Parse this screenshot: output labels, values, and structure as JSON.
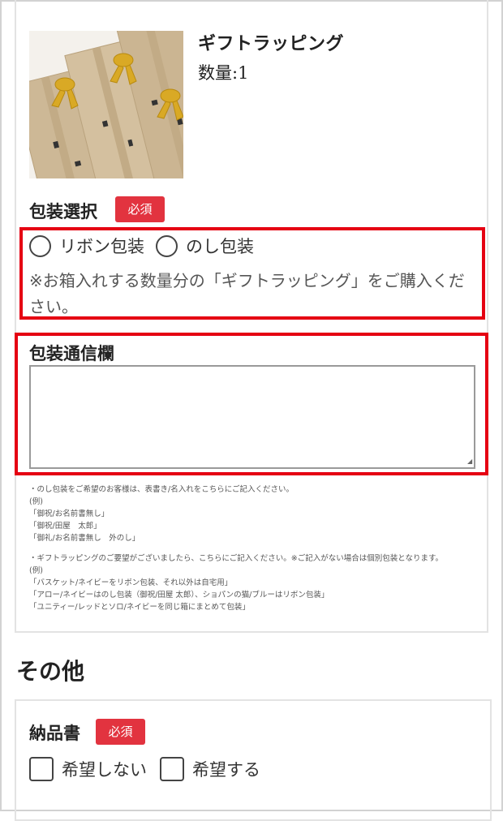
{
  "product": {
    "name": "ギフトラッピング",
    "quantity_label": "数量:1"
  },
  "packaging": {
    "title": "包装選択",
    "required_badge": "必須",
    "options": [
      "リボン包装",
      "のし包装"
    ],
    "note": "※お箱入れする数量分の「ギフトラッピング」をご購入ください。"
  },
  "message": {
    "title": "包装通信欄",
    "value": ""
  },
  "instructions": [
    "・のし包装をご希望のお客様は、表書き/名入れをこちらにご記入ください。",
    "(例)",
    "「御祝/お名前書無し」",
    "「御祝/田屋　太郎」",
    "「御礼/お名前書無し　外のし」",
    "",
    "・ギフトラッピングのご要望がございましたら、こちらにご記入ください。※ご記入がない場合は個別包装となります。",
    "(例)",
    "「バスケット/ネイビーをリボン包装、それ以外は自宅用」",
    "「アロー/ネイビーはのし包装（御祝/田屋 太郎）、ショパンの猫/ブルーはリボン包装」",
    "「ユニティー/レッドとソロ/ネイビーを同じ箱にまとめて包装」"
  ],
  "other": {
    "heading": "その他",
    "delivery_slip": {
      "title": "納品書",
      "required_badge": "必須",
      "options": [
        "希望しない",
        "希望する"
      ]
    }
  },
  "colors": {
    "highlight": "#e50012",
    "badge": "#e2333f"
  }
}
